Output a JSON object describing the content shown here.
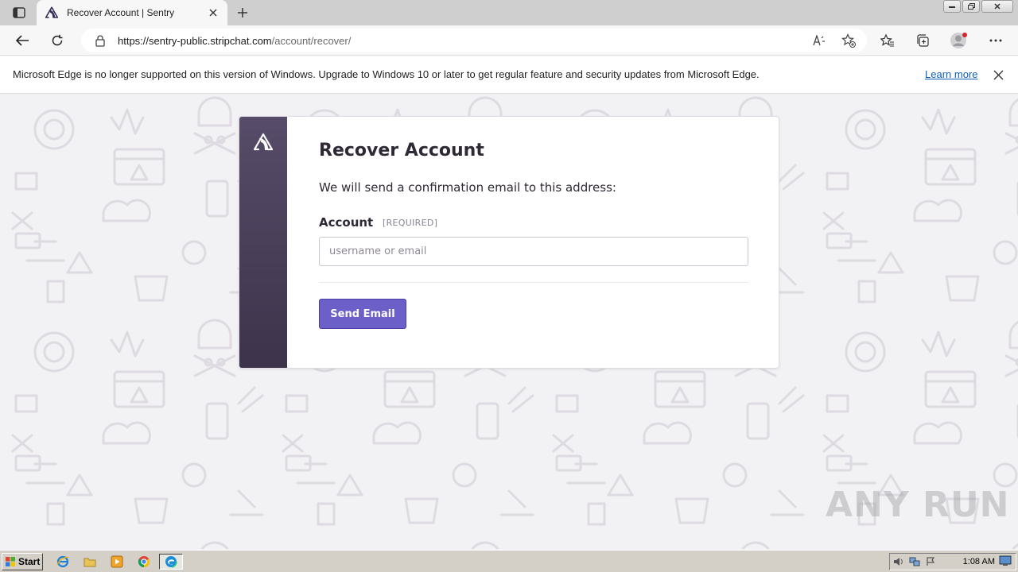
{
  "browser": {
    "tab_title": "Recover Account | Sentry",
    "url_host": "https://sentry-public.stripchat.com",
    "url_path": "/account/recover/"
  },
  "infobar": {
    "message": "Microsoft Edge is no longer supported on this version of Windows. Upgrade to Windows 10 or later to get regular feature and security updates from Microsoft Edge.",
    "learn_more": "Learn more"
  },
  "form": {
    "title": "Recover Account",
    "lead": "We will send a confirmation email to this address:",
    "account_label": "Account",
    "required_tag": "[REQUIRED]",
    "account_placeholder": "username or email",
    "submit_label": "Send Email"
  },
  "watermark": "ANY RUN",
  "taskbar": {
    "start_label": "Start",
    "clock": "1:08 AM"
  },
  "colors": {
    "sidebar": "#4e4360",
    "button": "#6c5fc7",
    "link": "#0f5fb8"
  }
}
